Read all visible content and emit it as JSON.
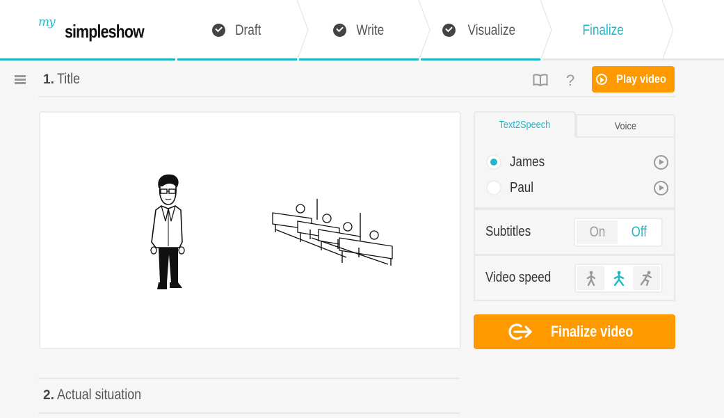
{
  "brand": {
    "prefix": "my",
    "name": "simpleshow",
    "accent": "#1fb8c6",
    "action_color": "#ff9900"
  },
  "steps": [
    {
      "label": "Draft",
      "status": "done"
    },
    {
      "label": "Write",
      "status": "done"
    },
    {
      "label": "Visualize",
      "status": "done"
    },
    {
      "label": "Finalize",
      "status": "active"
    }
  ],
  "scene1": {
    "number": "1.",
    "title": "Title"
  },
  "toolbar": {
    "storyboard_icon": "book-icon",
    "help_label": "?",
    "play_label": "Play video"
  },
  "canvas": {
    "characters": [
      {
        "name": "man-with-glasses-illustration"
      },
      {
        "name": "hospital-beds-illustration"
      }
    ]
  },
  "audio_panel": {
    "tabs": [
      {
        "label": "Text2Speech",
        "active": true
      },
      {
        "label": "Voice",
        "active": false
      }
    ],
    "voices": [
      {
        "name": "James",
        "selected": true
      },
      {
        "name": "Paul",
        "selected": false
      }
    ]
  },
  "subtitles": {
    "label": "Subtitles",
    "options": [
      "On",
      "Off"
    ],
    "selected": "Off"
  },
  "video_speed": {
    "label": "Video speed",
    "options": [
      "slow",
      "normal",
      "fast"
    ],
    "selected": "normal"
  },
  "finalize": {
    "label": "Finalize video"
  },
  "scene2": {
    "number": "2.",
    "title": "Actual situation"
  }
}
